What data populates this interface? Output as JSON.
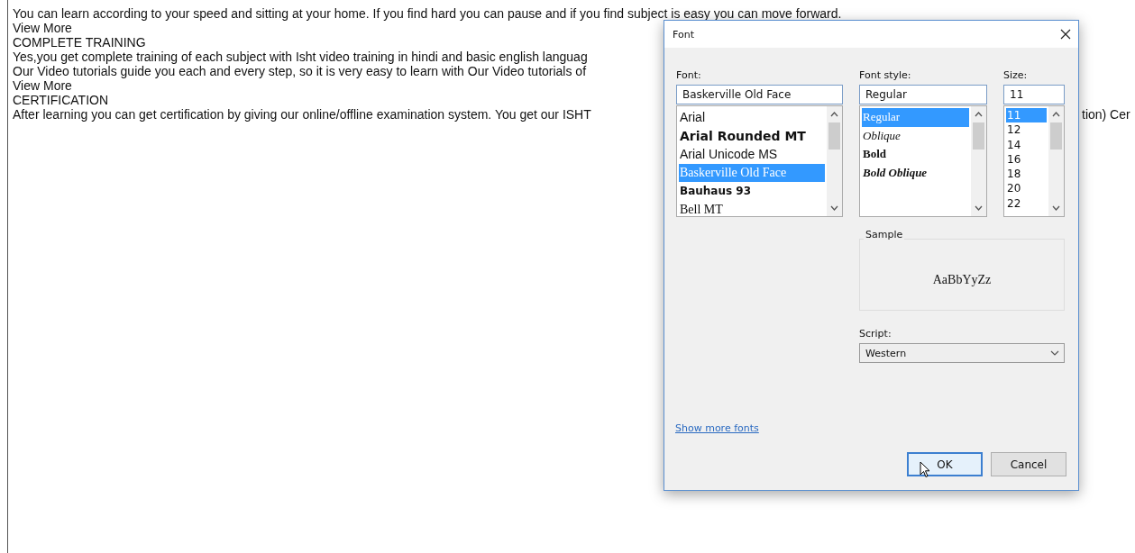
{
  "page": {
    "lines": [
      {
        "text": "You can learn according to your speed and sitting at your home. If you find hard you can pause and if you find subject is easy you can move forward."
      },
      {
        "text": "View More"
      },
      {
        "text": "COMPLETE TRAINING"
      },
      {
        "text": "Yes,you get complete training of each subject with Isht video training in hindi and basic english languag"
      },
      {
        "text": "Our Video tutorials guide you each and every step, so it is very easy to learn with Our Video tutorials of"
      },
      {
        "text": "View More"
      },
      {
        "text": "CERTIFICATION"
      },
      {
        "text": "After learning you can get certification by giving our online/offline examination system. You get our ISHT",
        "right_fragment": "tion) Cer"
      }
    ]
  },
  "dialog": {
    "title": "Font",
    "font": {
      "label": "Font:",
      "value": "Baskerville Old Face",
      "items": [
        {
          "label": "Arial",
          "kind": "sans",
          "selected": false
        },
        {
          "label": "Arial Rounded MT",
          "kind": "sans-bold",
          "selected": false
        },
        {
          "label": "Arial Unicode MS",
          "kind": "sans",
          "selected": false
        },
        {
          "label": "Baskerville Old Face",
          "kind": "serif",
          "selected": true
        },
        {
          "label": "Bauhaus 93",
          "kind": "display",
          "selected": false
        },
        {
          "label": "Bell MT",
          "kind": "serif",
          "selected": false
        }
      ]
    },
    "style": {
      "label": "Font style:",
      "value": "Regular",
      "items": [
        {
          "label": "Regular",
          "kind": "regular",
          "selected": true
        },
        {
          "label": "Oblique",
          "kind": "italic",
          "selected": false
        },
        {
          "label": "Bold",
          "kind": "bold",
          "selected": false
        },
        {
          "label": "Bold Oblique",
          "kind": "bold-italic",
          "selected": false
        }
      ]
    },
    "size": {
      "label": "Size:",
      "value": "11",
      "items": [
        {
          "label": "11",
          "selected": true
        },
        {
          "label": "12",
          "selected": false
        },
        {
          "label": "14",
          "selected": false
        },
        {
          "label": "16",
          "selected": false
        },
        {
          "label": "18",
          "selected": false
        },
        {
          "label": "20",
          "selected": false
        },
        {
          "label": "22",
          "selected": false
        }
      ]
    },
    "sample": {
      "label": "Sample",
      "text": "AaBbYyZz"
    },
    "script": {
      "label": "Script:",
      "value": "Western"
    },
    "link": "Show more fonts",
    "buttons": [
      {
        "label": "OK",
        "kind": "default"
      },
      {
        "label": "Cancel",
        "kind": "normal"
      }
    ]
  }
}
